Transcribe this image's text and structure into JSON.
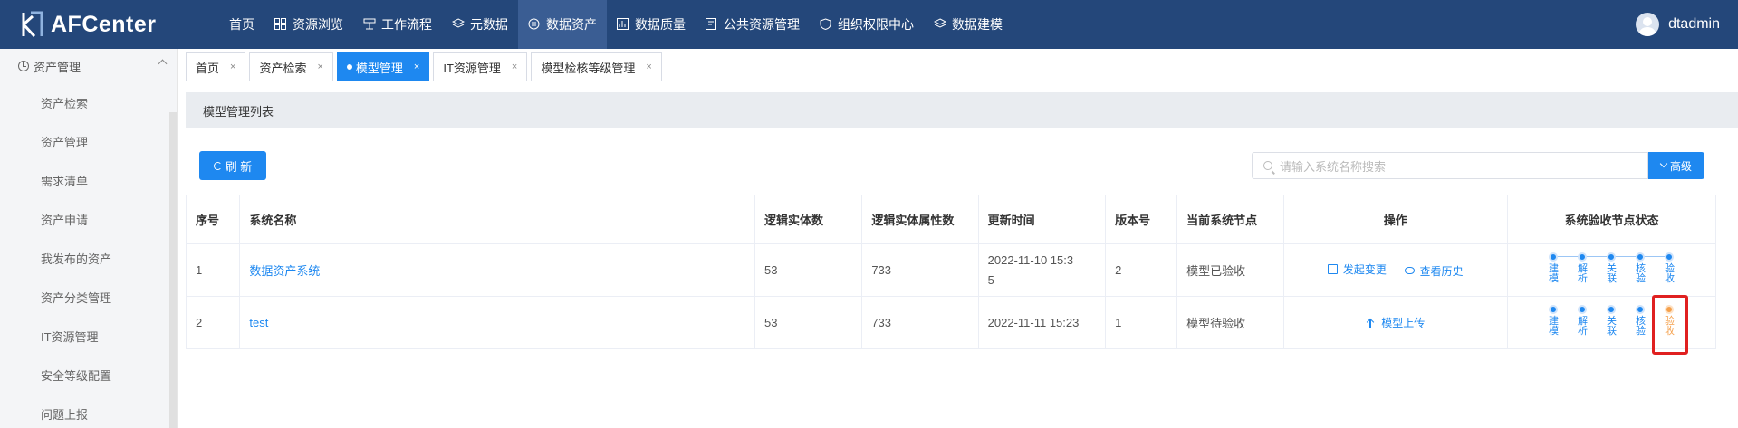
{
  "app": {
    "title": "AFCenter"
  },
  "nav": [
    {
      "label": "首页",
      "icon": "none"
    },
    {
      "label": "资源浏览",
      "icon": "grid-icon"
    },
    {
      "label": "工作流程",
      "icon": "workflow-icon"
    },
    {
      "label": "元数据",
      "icon": "layers-icon"
    },
    {
      "label": "数据资产",
      "icon": "asset-icon",
      "active": true
    },
    {
      "label": "数据质量",
      "icon": "chart-icon"
    },
    {
      "label": "公共资源管理",
      "icon": "folder-icon"
    },
    {
      "label": "组织权限中心",
      "icon": "shield-icon"
    },
    {
      "label": "数据建模",
      "icon": "layers-icon"
    }
  ],
  "user": {
    "name": "dtadmin"
  },
  "sidebar": {
    "group": "资产管理",
    "items": [
      "资产检索",
      "资产管理",
      "需求清单",
      "资产申请",
      "我发布的资产",
      "资产分类管理",
      "IT资源管理",
      "安全等级配置",
      "问题上报"
    ]
  },
  "tabs": [
    {
      "label": "首页"
    },
    {
      "label": "资产检索"
    },
    {
      "label": "模型管理",
      "active": true
    },
    {
      "label": "IT资源管理"
    },
    {
      "label": "模型检核等级管理"
    }
  ],
  "panel": {
    "title": "模型管理列表",
    "refresh_label": "刷 新",
    "search_placeholder": "请输入系统名称搜索",
    "advanced_label": "高级"
  },
  "table": {
    "headers": [
      "序号",
      "系统名称",
      "逻辑实体数",
      "逻辑实体属性数",
      "更新时间",
      "版本号",
      "当前系统节点",
      "操作",
      "系统验收节点状态"
    ],
    "rows": [
      {
        "index": "1",
        "name": "数据资产系统",
        "entities": "53",
        "attributes": "733",
        "updated": "2022-11-10 15:35",
        "version": "2",
        "node": "模型已验收",
        "actions": [
          "发起变更",
          "查看历史"
        ],
        "steps": [
          {
            "label": "建模",
            "state": "done"
          },
          {
            "label": "解析",
            "state": "done"
          },
          {
            "label": "关联",
            "state": "done"
          },
          {
            "label": "核验",
            "state": "done"
          },
          {
            "label": "验收",
            "state": "done"
          }
        ]
      },
      {
        "index": "2",
        "name": "test",
        "entities": "53",
        "attributes": "733",
        "updated": "2022-11-11 15:23",
        "version": "1",
        "node": "模型待验收",
        "actions": [
          "模型上传"
        ],
        "steps": [
          {
            "label": "建模",
            "state": "done"
          },
          {
            "label": "解析",
            "state": "done"
          },
          {
            "label": "关联",
            "state": "done"
          },
          {
            "label": "核验",
            "state": "done"
          },
          {
            "label": "验收",
            "state": "pending"
          }
        ]
      }
    ]
  },
  "colors": {
    "header_bg": "#24477a",
    "accent": "#1e88f0",
    "pending": "#f5a04b",
    "highlight": "#e02020"
  }
}
